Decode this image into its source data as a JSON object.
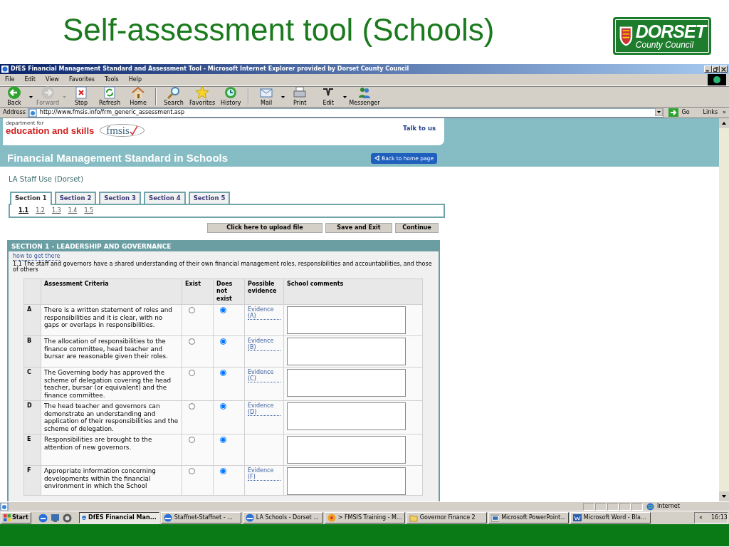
{
  "slide": {
    "title": "Self-assessment tool (Schools)",
    "logo": {
      "name": "DORSET",
      "subtitle": "County Council"
    }
  },
  "window": {
    "title": "DfES Financial Management Standard and Assessment Tool - Microsoft Internet Explorer provided by Dorset County Council"
  },
  "menu": [
    "File",
    "Edit",
    "View",
    "Favorites",
    "Tools",
    "Help"
  ],
  "toolbar": [
    {
      "kind": "back",
      "label": "Back",
      "disabled": false,
      "dropdown": true
    },
    {
      "kind": "forward",
      "label": "Forward",
      "disabled": true,
      "dropdown": true
    },
    {
      "kind": "stop",
      "label": "Stop",
      "disabled": false,
      "dropdown": false
    },
    {
      "kind": "refresh",
      "label": "Refresh",
      "disabled": false,
      "dropdown": false
    },
    {
      "kind": "home",
      "label": "Home",
      "disabled": false,
      "dropdown": false
    },
    {
      "kind": "search",
      "label": "Search",
      "disabled": false,
      "dropdown": false
    },
    {
      "kind": "favorites",
      "label": "Favorites",
      "disabled": false,
      "dropdown": false
    },
    {
      "kind": "history",
      "label": "History",
      "disabled": false,
      "dropdown": false
    },
    {
      "kind": "mail",
      "label": "Mail",
      "disabled": false,
      "dropdown": true
    },
    {
      "kind": "print",
      "label": "Print",
      "disabled": false,
      "dropdown": false
    },
    {
      "kind": "edit",
      "label": "Edit",
      "disabled": false,
      "dropdown": true
    },
    {
      "kind": "messenger",
      "label": "Messenger",
      "disabled": false,
      "dropdown": false
    }
  ],
  "address": {
    "label": "Address",
    "url": "http://www.fmsis.info/frm_generic_assessment.asp",
    "go": "Go",
    "links": "Links",
    "more": "»"
  },
  "page": {
    "dept_small": "department for",
    "dept": "education and skills",
    "fmsis": "fmsis",
    "talk": "Talk to us",
    "banner": "Financial Management Standard in Schools",
    "back": "Back to home page",
    "user": "LA Staff Use (Dorset)",
    "tabs": [
      {
        "label": "Section 1",
        "selected": true
      },
      {
        "label": "Section 2",
        "selected": false
      },
      {
        "label": "Section 3",
        "selected": false
      },
      {
        "label": "Section 4",
        "selected": false
      },
      {
        "label": "Section 5",
        "selected": false
      }
    ],
    "subtabs": [
      {
        "label": "1.1",
        "selected": true
      },
      {
        "label": "1.2",
        "selected": false
      },
      {
        "label": "1.3",
        "selected": false
      },
      {
        "label": "1.4",
        "selected": false
      },
      {
        "label": "1.5",
        "selected": false
      }
    ],
    "actions": [
      "Click here to upload file",
      "Save and Exit",
      "Continue"
    ],
    "section": {
      "title": "SECTION 1 - LEADERSHIP AND GOVERNANCE",
      "link": "how to get there",
      "statement": "1.1 The staff and governors have a shared understanding of their own financial management roles, responsibilities and accountabilities, and those of others",
      "columns": [
        "Assessment Criteria",
        "Exist",
        "Does not exist",
        "Possible evidence",
        "School comments"
      ],
      "rows": [
        {
          "letter": "A",
          "criteria": "There is a written statement of roles and responsibilities and it is clear, with no gaps or overlaps in responsibilities.",
          "choices": [
            {
              "selected": false
            },
            {
              "selected": true
            }
          ],
          "evidence": "Evidence (A)"
        },
        {
          "letter": "B",
          "criteria": "The allocation of responsibilities to the finance committee, head teacher and bursar are reasonable given their roles.",
          "choices": [
            {
              "selected": false
            },
            {
              "selected": true
            }
          ],
          "evidence": "Evidence (B)"
        },
        {
          "letter": "C",
          "criteria": "The Governing body has approved the scheme of delegation covering the head teacher, bursar (or equivalent) and the finance committee.",
          "choices": [
            {
              "selected": false
            },
            {
              "selected": true
            }
          ],
          "evidence": "Evidence (C)"
        },
        {
          "letter": "D",
          "criteria": "The head teacher and governors can demonstrate an understanding and application of their responsibilities and the scheme of delegation.",
          "choices": [
            {
              "selected": false
            },
            {
              "selected": true
            }
          ],
          "evidence": "Evidence (D)"
        },
        {
          "letter": "E",
          "criteria": "Responsibilities are brought to the attention of new governors.",
          "choices": [
            {
              "selected": false
            },
            {
              "selected": true
            }
          ]
        },
        {
          "letter": "F",
          "criteria": "Appropriate information concerning developments within the financial environment in which the School",
          "choices": [
            {
              "selected": false
            },
            {
              "selected": true
            }
          ],
          "evidence": "Evidence (F)"
        }
      ]
    }
  },
  "status_bar": {
    "zone": "Internet"
  },
  "taskbar": {
    "start": "Start",
    "tasks": [
      {
        "label": "DfES Financial Man...",
        "kind": "ie",
        "selected": true
      },
      {
        "label": "Staffnet-Staffnet - ...",
        "kind": "ie",
        "selected": false
      },
      {
        "label": "LA Schools - Dorset ...",
        "kind": "ie",
        "selected": false
      },
      {
        "label": "> FMSIS Training - M...",
        "kind": "media",
        "selected": false
      },
      {
        "label": "Governor Finance 2",
        "kind": "folder",
        "selected": false
      },
      {
        "label": "Microsoft PowerPoint...",
        "kind": "powerpoint",
        "selected": false
      },
      {
        "label": "Microsoft Word - Bla...",
        "kind": "word",
        "selected": false
      }
    ],
    "expand": "«",
    "clock": "16:13"
  }
}
